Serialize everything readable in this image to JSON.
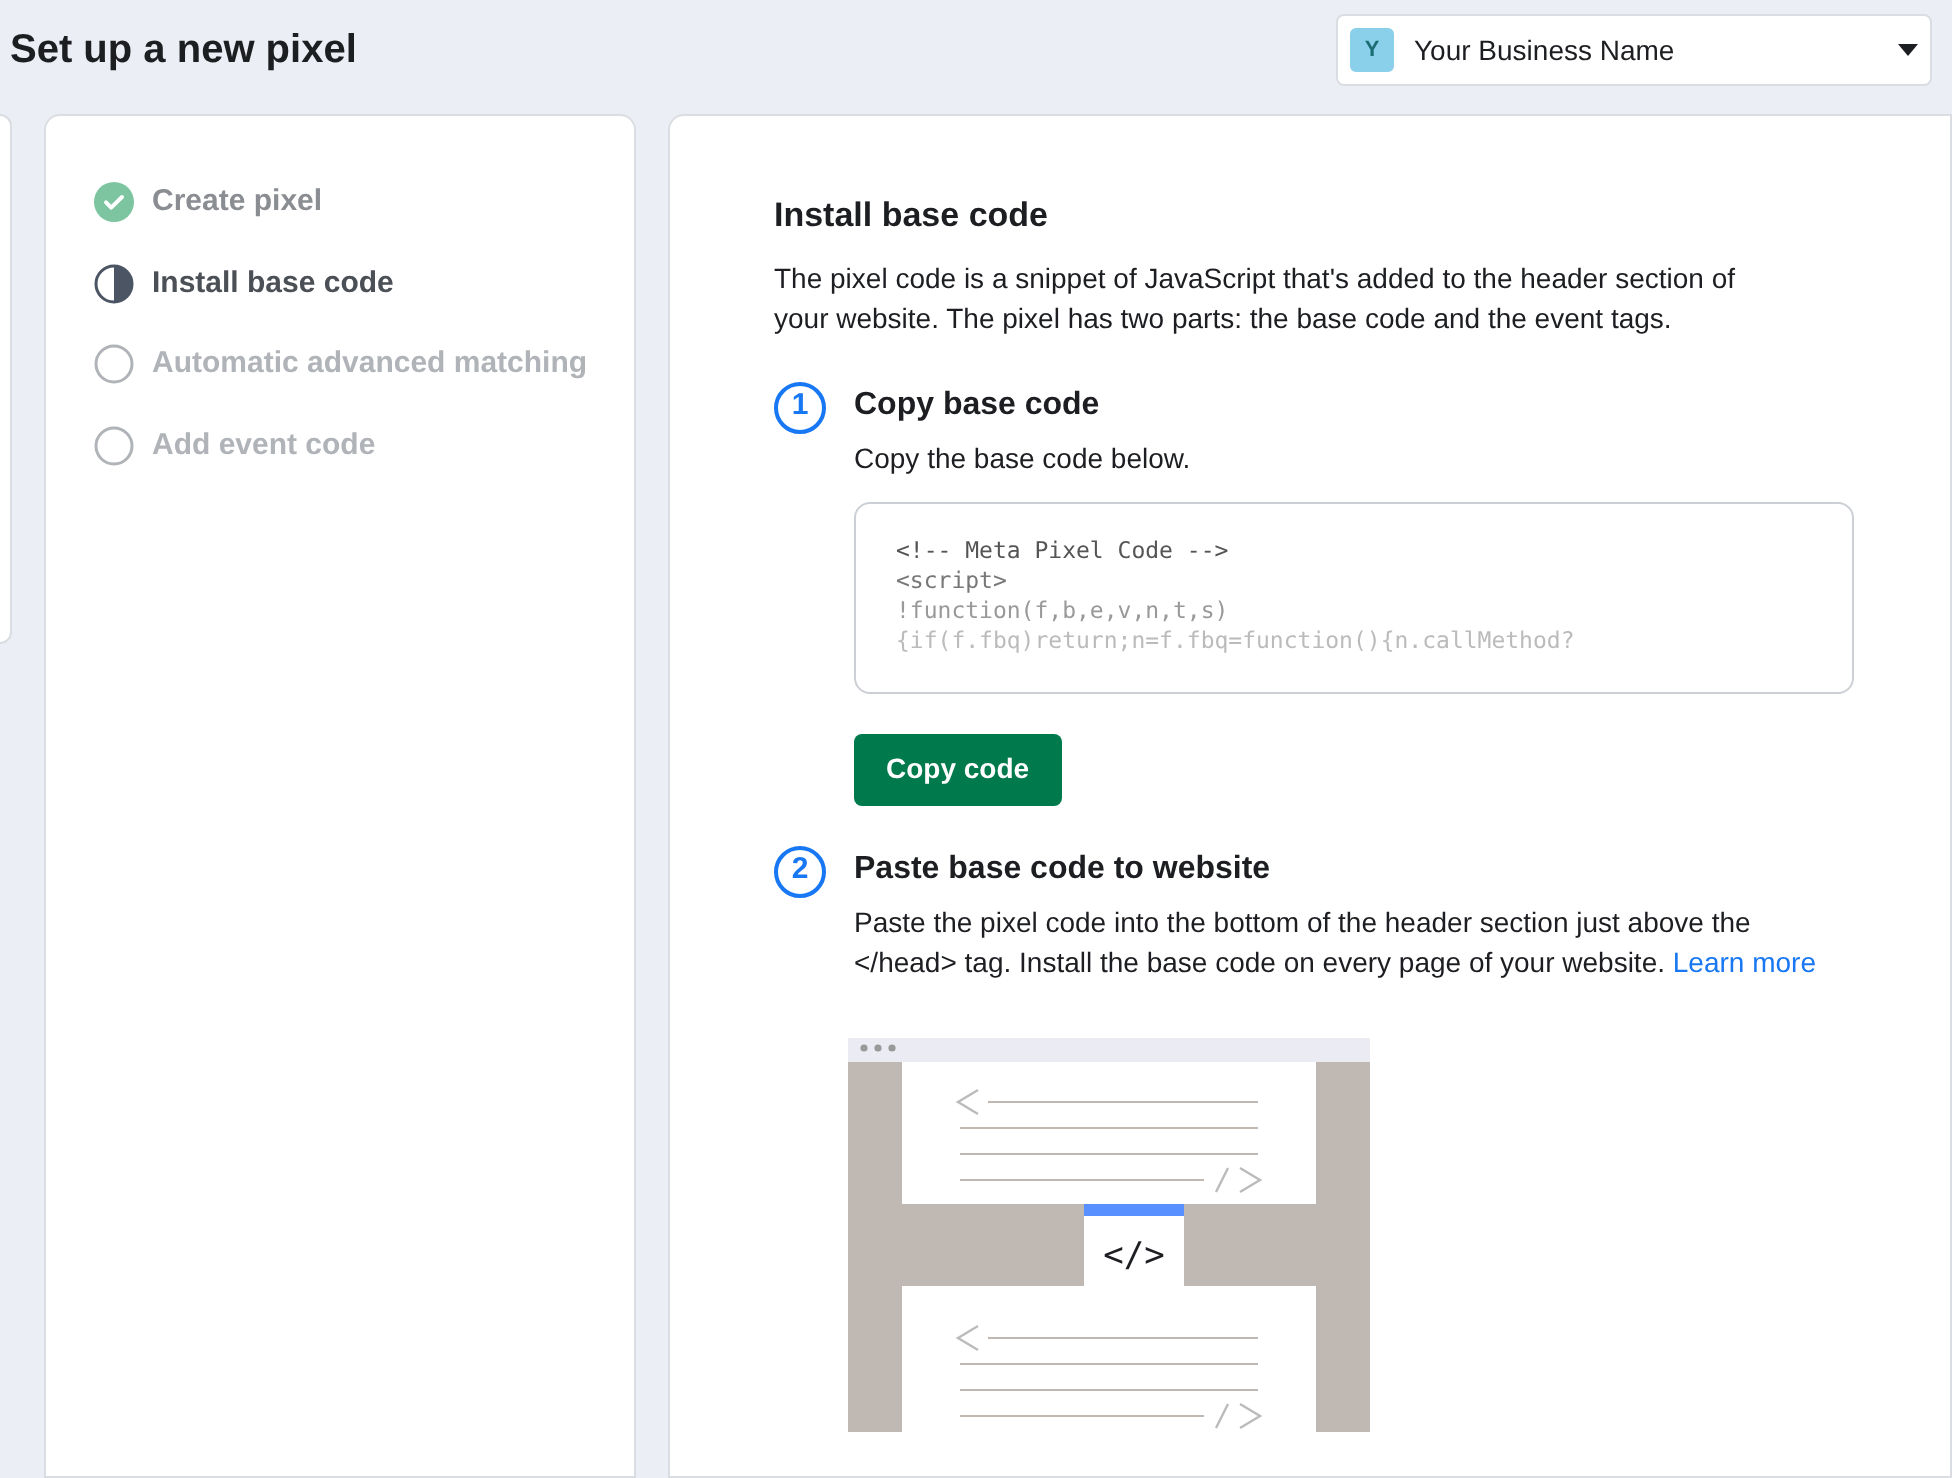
{
  "page_title": "Set up a new pixel",
  "account": {
    "initial": "Y",
    "name": "Your Business Name"
  },
  "steps": [
    {
      "label": "Create pixel",
      "kind": "done"
    },
    {
      "label": "Install base code",
      "kind": "current"
    },
    {
      "label": "Automatic advanced matching",
      "kind": "todo"
    },
    {
      "label": "Add event code",
      "kind": "todo"
    }
  ],
  "main": {
    "title": "Install base code",
    "intro": "The pixel code is a snippet of JavaScript that's added to the header section of your website. The pixel has two parts: the base code and the event tags.",
    "instructions": [
      {
        "number": "1",
        "title": "Copy base code",
        "text": "Copy the base code below.",
        "code_lines": [
          "<!-- Meta Pixel Code -->",
          "<script>",
          "!function(f,b,e,v,n,t,s)",
          "{if(f.fbq)return;n=f.fbq=function(){n.callMethod?"
        ],
        "button": "Copy code"
      },
      {
        "number": "2",
        "title": "Paste base code to website",
        "text": "Paste the pixel code into the bottom of the header section just above the </head> tag. Install the base code on every page of your website.",
        "link": "Learn more",
        "illustration_label": "</>"
      }
    ]
  }
}
